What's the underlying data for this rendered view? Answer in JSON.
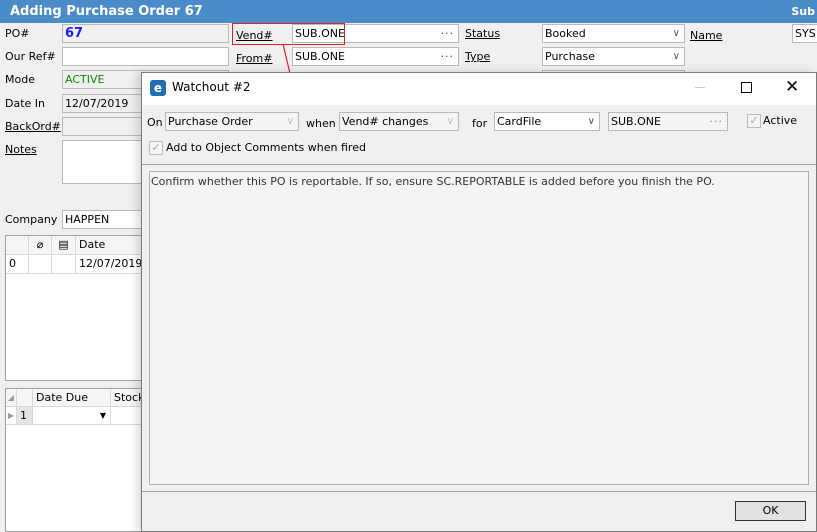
{
  "window": {
    "title": "Adding Purchase Order 67",
    "right_title": "Sub"
  },
  "form": {
    "po_label": "PO#",
    "po_value": "67",
    "ourref_label": "Our Ref#",
    "ourref_value": "",
    "mode_label": "Mode",
    "mode_value": "ACTIVE",
    "datein_label": "Date In",
    "datein_value": "12/07/2019",
    "backord_label": "BackOrd#",
    "backord_value": "",
    "notes_label": "Notes",
    "notes_value": "",
    "company_label": "Company",
    "company_value": "HAPPEN",
    "vend_label": "Vend#",
    "vend_value": "SUB.ONE",
    "from_label": "From#",
    "from_value": "SUB.ONE",
    "status_label": "Status",
    "status_value": "Booked",
    "type_label": "Type",
    "type_value": "Purchase",
    "name_label": "Name",
    "name_value": "SYS"
  },
  "grid1": {
    "headers": [
      "",
      "",
      "",
      "Date"
    ],
    "rows": [
      [
        "0",
        "",
        "",
        "12/07/2019"
      ]
    ]
  },
  "grid2": {
    "headers": [
      "",
      "",
      "Date Due",
      "Stock"
    ],
    "rows": [
      [
        "",
        "1",
        "",
        ""
      ]
    ]
  },
  "dialog": {
    "title": "Watchout #2",
    "on_label": "On",
    "on_value": "Purchase Order",
    "when_label": "when",
    "when_value": "Vend# changes",
    "for_label": "for",
    "for_value": "CardFile",
    "card_value": "SUB.ONE",
    "active_label": "Active",
    "active_checked": true,
    "add_comments_label": "Add to Object Comments when fired",
    "add_comments_checked": true,
    "message": "Confirm whether this PO is reportable. If so, ensure SC.REPORTABLE is added before you finish the PO.",
    "ok_label": "OK"
  },
  "colors": {
    "title_bar": "#4a8bc9",
    "po_number": "#1a1aff",
    "mode": "#0a8a0a",
    "highlight": "#e02020"
  }
}
